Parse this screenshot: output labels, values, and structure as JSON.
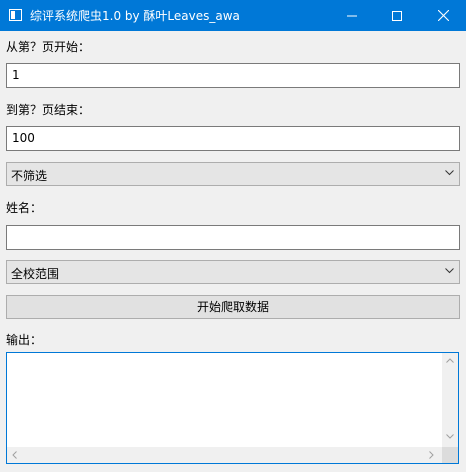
{
  "window": {
    "title": "综评系统爬虫1.0 by 酥叶Leaves_awa",
    "icon": "app-window-icon",
    "controls": [
      "minimize-icon",
      "maximize-icon",
      "close-icon"
    ]
  },
  "form": {
    "start_page_label": "从第？页开始：",
    "start_page_value": "1",
    "end_page_label": "到第？页结束：",
    "end_page_value": "100",
    "filter_select": "不筛选",
    "name_label": "姓名：",
    "name_value": "",
    "scope_select": "全校范围",
    "start_button": "开始爬取数据",
    "output_label": "输出：",
    "output_value": ""
  },
  "colors": {
    "titlebar": "#0078d7",
    "window_bg": "#f0f0f0",
    "focus_border": "#0078d7"
  }
}
